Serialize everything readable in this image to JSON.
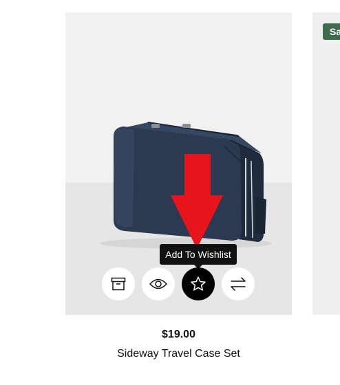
{
  "product": {
    "price": "$19.00",
    "title": "Sideway Travel Case Set"
  },
  "tooltip": {
    "text": "Add To Wishlist"
  },
  "actions": [
    {
      "name": "add-to-cart-button",
      "icon": "box-icon"
    },
    {
      "name": "quick-view-button",
      "icon": "eye-icon"
    },
    {
      "name": "add-to-wishlist-button",
      "icon": "star-icon",
      "active": true
    },
    {
      "name": "compare-button",
      "icon": "arrows-swap-icon"
    }
  ],
  "neighbor": {
    "badge": "Sale"
  },
  "colors": {
    "badge": "#3f6b4f",
    "arrow": "#e8141b",
    "active_button": "#000000",
    "bag": "#2b3a50"
  }
}
